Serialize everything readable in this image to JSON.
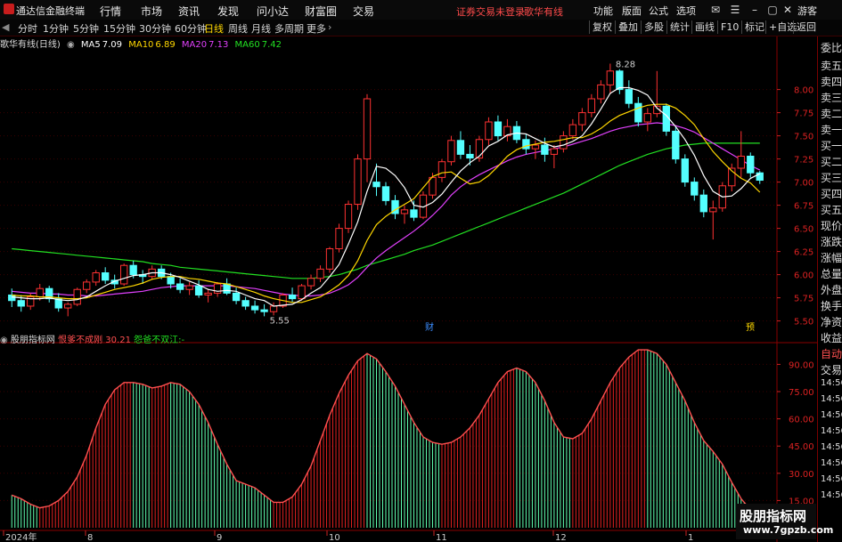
{
  "titlebar": {
    "app_title": "通达信金融终端",
    "menus": [
      "行情",
      "市场",
      "资讯",
      "发现",
      "问小达",
      "财富圈",
      "交易"
    ],
    "warning": "证券交易未登录",
    "stock_name": "歌华有线",
    "right_menus": [
      "功能",
      "版面",
      "公式",
      "选项"
    ],
    "user": "游客"
  },
  "toolbar": {
    "periods": [
      "分时",
      "1分钟",
      "5分钟",
      "15分钟",
      "30分钟",
      "60分钟",
      "日线",
      "周线",
      "月线",
      "多周期",
      "更多"
    ],
    "active_period": "日线",
    "buttons": [
      "复权",
      "叠加",
      "多股",
      "统计",
      "画线",
      "F10",
      "标记",
      "+自选",
      "返回"
    ]
  },
  "main_chart": {
    "label": "歌华有线(日线)",
    "ma": [
      {
        "name": "MA5",
        "value": "7.09",
        "color": "#ffffff"
      },
      {
        "name": "MA10",
        "value": "6.89",
        "color": "#ffd700"
      },
      {
        "name": "MA20",
        "value": "7.13",
        "color": "#e040fb"
      },
      {
        "name": "MA60",
        "value": "7.42",
        "color": "#22e022"
      }
    ],
    "high_label": "8.28",
    "low_label": "5.55",
    "markers": [
      "财",
      "预"
    ]
  },
  "indicator": {
    "name": "股朋指标网",
    "line1_label": "恨爹不成刚",
    "line1_value": "30.21",
    "line2_label": "怨爸不双江",
    "line2_value": "-"
  },
  "right_panel": {
    "items": [
      "委比",
      "卖五",
      "卖四",
      "卖三",
      "卖二",
      "卖一",
      "买一",
      "买二",
      "买三",
      "买四",
      "买五",
      "现价",
      "涨跌",
      "涨幅",
      "总量",
      "外盘",
      "换手",
      "净资",
      "收益",
      "自动",
      "交易"
    ],
    "times": [
      "14:56",
      "14:56",
      "14:56",
      "14:56",
      "14:56",
      "14:56",
      "14:56",
      "14:56"
    ]
  },
  "watermark": {
    "name": "股朋指标网",
    "url": "www.7gpzb.com"
  },
  "chart_data": {
    "type": "candlestick",
    "price_axis": {
      "ticks": [
        "8.00",
        "7.75",
        "7.50",
        "7.25",
        "7.00",
        "6.75",
        "6.50",
        "6.25",
        "6.00",
        "5.75",
        "5.50"
      ],
      "range": [
        5.4,
        8.4
      ]
    },
    "indicator_axis": {
      "ticks": [
        "90.00",
        "75.00",
        "60.00",
        "45.00",
        "30.00",
        "15.00"
      ],
      "range": [
        0,
        100
      ]
    },
    "x_labels": [
      "2024年",
      "8",
      "9",
      "10",
      "11",
      "12",
      "1"
    ],
    "ohlc": [
      [
        5.78,
        5.85,
        5.65,
        5.72
      ],
      [
        5.72,
        5.78,
        5.6,
        5.66
      ],
      [
        5.66,
        5.8,
        5.62,
        5.76
      ],
      [
        5.76,
        5.9,
        5.72,
        5.85
      ],
      [
        5.85,
        5.88,
        5.7,
        5.74
      ],
      [
        5.74,
        5.8,
        5.6,
        5.64
      ],
      [
        5.64,
        5.7,
        5.55,
        5.68
      ],
      [
        5.68,
        5.86,
        5.66,
        5.84
      ],
      [
        5.84,
        5.95,
        5.8,
        5.92
      ],
      [
        5.92,
        6.05,
        5.88,
        6.02
      ],
      [
        6.02,
        6.08,
        5.9,
        5.94
      ],
      [
        5.94,
        6.0,
        5.85,
        5.9
      ],
      [
        5.9,
        6.12,
        5.88,
        6.1
      ],
      [
        6.1,
        6.15,
        5.96,
        6.0
      ],
      [
        6.0,
        6.05,
        5.9,
        5.98
      ],
      [
        5.98,
        6.1,
        5.95,
        6.06
      ],
      [
        6.06,
        6.1,
        5.95,
        5.98
      ],
      [
        5.98,
        6.02,
        5.85,
        5.9
      ],
      [
        5.9,
        5.96,
        5.8,
        5.84
      ],
      [
        5.84,
        5.92,
        5.78,
        5.88
      ],
      [
        5.88,
        5.94,
        5.75,
        5.78
      ],
      [
        5.78,
        5.84,
        5.7,
        5.8
      ],
      [
        5.8,
        5.92,
        5.76,
        5.9
      ],
      [
        5.9,
        5.96,
        5.78,
        5.8
      ],
      [
        5.8,
        5.86,
        5.68,
        5.72
      ],
      [
        5.72,
        5.76,
        5.62,
        5.66
      ],
      [
        5.66,
        5.72,
        5.58,
        5.62
      ],
      [
        5.62,
        5.68,
        5.55,
        5.6
      ],
      [
        5.6,
        5.7,
        5.56,
        5.66
      ],
      [
        5.66,
        5.8,
        5.64,
        5.78
      ],
      [
        5.78,
        5.86,
        5.7,
        5.74
      ],
      [
        5.74,
        5.9,
        5.72,
        5.88
      ],
      [
        5.88,
        6.0,
        5.84,
        5.96
      ],
      [
        5.96,
        6.1,
        5.92,
        6.06
      ],
      [
        6.06,
        6.3,
        6.02,
        6.28
      ],
      [
        6.28,
        6.55,
        6.24,
        6.5
      ],
      [
        6.5,
        6.8,
        6.45,
        6.76
      ],
      [
        6.76,
        7.3,
        6.7,
        7.25
      ],
      [
        7.25,
        7.95,
        7.0,
        7.9
      ],
      [
        7.0,
        7.2,
        6.85,
        6.95
      ],
      [
        6.95,
        7.0,
        6.75,
        6.8
      ],
      [
        6.8,
        6.86,
        6.6,
        6.66
      ],
      [
        6.66,
        6.75,
        6.55,
        6.7
      ],
      [
        6.7,
        6.8,
        6.58,
        6.62
      ],
      [
        6.62,
        6.9,
        6.6,
        6.86
      ],
      [
        6.86,
        7.1,
        6.82,
        7.05
      ],
      [
        7.05,
        7.25,
        7.0,
        7.22
      ],
      [
        7.22,
        7.5,
        7.18,
        7.45
      ],
      [
        7.45,
        7.55,
        7.25,
        7.3
      ],
      [
        7.3,
        7.4,
        7.18,
        7.26
      ],
      [
        7.26,
        7.5,
        7.22,
        7.46
      ],
      [
        7.46,
        7.7,
        7.4,
        7.65
      ],
      [
        7.65,
        7.72,
        7.45,
        7.5
      ],
      [
        7.5,
        7.68,
        7.44,
        7.6
      ],
      [
        7.6,
        7.66,
        7.42,
        7.46
      ],
      [
        7.46,
        7.52,
        7.3,
        7.36
      ],
      [
        7.36,
        7.45,
        7.25,
        7.4
      ],
      [
        7.4,
        7.48,
        7.22,
        7.3
      ],
      [
        7.3,
        7.4,
        7.15,
        7.36
      ],
      [
        7.36,
        7.55,
        7.32,
        7.5
      ],
      [
        7.5,
        7.68,
        7.46,
        7.62
      ],
      [
        7.62,
        7.8,
        7.55,
        7.75
      ],
      [
        7.75,
        7.95,
        7.7,
        7.9
      ],
      [
        7.9,
        8.1,
        7.85,
        8.05
      ],
      [
        8.05,
        8.28,
        7.95,
        8.2
      ],
      [
        8.2,
        8.22,
        7.95,
        8.0
      ],
      [
        8.0,
        8.1,
        7.8,
        7.85
      ],
      [
        7.85,
        7.92,
        7.6,
        7.65
      ],
      [
        7.65,
        7.8,
        7.55,
        7.74
      ],
      [
        7.74,
        8.2,
        7.7,
        7.82
      ],
      [
        7.82,
        7.85,
        7.5,
        7.55
      ],
      [
        7.55,
        7.6,
        7.2,
        7.25
      ],
      [
        7.25,
        7.3,
        6.95,
        7.0
      ],
      [
        7.0,
        7.05,
        6.8,
        6.86
      ],
      [
        6.86,
        6.92,
        6.62,
        6.68
      ],
      [
        6.68,
        6.8,
        6.38,
        6.72
      ],
      [
        6.72,
        7.0,
        6.68,
        6.96
      ],
      [
        6.96,
        7.2,
        6.9,
        7.15
      ],
      [
        7.15,
        7.55,
        7.05,
        7.28
      ],
      [
        7.28,
        7.32,
        7.05,
        7.1
      ],
      [
        7.1,
        7.12,
        6.98,
        7.02
      ]
    ],
    "ma5": [
      5.76,
      5.75,
      5.74,
      5.74,
      5.75,
      5.73,
      5.72,
      5.73,
      5.76,
      5.82,
      5.88,
      5.93,
      5.96,
      5.99,
      6.0,
      6.02,
      6.02,
      6.0,
      5.97,
      5.93,
      5.89,
      5.84,
      5.82,
      5.83,
      5.82,
      5.78,
      5.74,
      5.72,
      5.66,
      5.67,
      5.68,
      5.73,
      5.8,
      5.86,
      5.98,
      6.11,
      6.33,
      6.57,
      6.9,
      7.17,
      7.15,
      7.07,
      6.94,
      6.75,
      6.73,
      6.78,
      6.87,
      7.0,
      7.12,
      7.21,
      7.28,
      7.39,
      7.44,
      7.51,
      7.53,
      7.52,
      7.47,
      7.42,
      7.38,
      7.4,
      7.44,
      7.5,
      7.63,
      7.79,
      7.96,
      8.02,
      8.02,
      7.99,
      7.94,
      7.8,
      7.72,
      7.6,
      7.46,
      7.29,
      7.07,
      6.9,
      6.84,
      6.85,
      6.93,
      7.04,
      7.09
    ],
    "ma10": [
      5.78,
      5.77,
      5.77,
      5.76,
      5.76,
      5.75,
      5.74,
      5.74,
      5.75,
      5.78,
      5.81,
      5.84,
      5.86,
      5.88,
      5.91,
      5.95,
      5.97,
      5.98,
      5.98,
      5.96,
      5.95,
      5.93,
      5.91,
      5.9,
      5.87,
      5.84,
      5.81,
      5.77,
      5.74,
      5.72,
      5.7,
      5.7,
      5.73,
      5.76,
      5.82,
      5.89,
      5.99,
      6.15,
      6.37,
      6.54,
      6.63,
      6.7,
      6.76,
      6.82,
      6.94,
      7.06,
      7.1,
      7.11,
      7.04,
      6.98,
      7.0,
      7.07,
      7.17,
      7.28,
      7.35,
      7.39,
      7.41,
      7.43,
      7.44,
      7.46,
      7.48,
      7.48,
      7.52,
      7.58,
      7.66,
      7.72,
      7.76,
      7.8,
      7.83,
      7.84,
      7.84,
      7.8,
      7.72,
      7.62,
      7.47,
      7.33,
      7.22,
      7.12,
      7.04,
      6.99,
      6.89
    ],
    "ma20": [
      5.82,
      5.81,
      5.8,
      5.8,
      5.79,
      5.79,
      5.78,
      5.78,
      5.77,
      5.77,
      5.78,
      5.79,
      5.8,
      5.81,
      5.82,
      5.84,
      5.86,
      5.87,
      5.88,
      5.88,
      5.88,
      5.88,
      5.88,
      5.88,
      5.87,
      5.86,
      5.85,
      5.83,
      5.81,
      5.79,
      5.78,
      5.77,
      5.77,
      5.78,
      5.8,
      5.84,
      5.89,
      5.97,
      6.08,
      6.18,
      6.26,
      6.33,
      6.4,
      6.47,
      6.55,
      6.64,
      6.74,
      6.86,
      6.95,
      7.02,
      7.08,
      7.13,
      7.18,
      7.23,
      7.27,
      7.3,
      7.32,
      7.34,
      7.36,
      7.38,
      7.41,
      7.44,
      7.47,
      7.51,
      7.55,
      7.58,
      7.6,
      7.62,
      7.63,
      7.64,
      7.63,
      7.61,
      7.58,
      7.54,
      7.48,
      7.42,
      7.36,
      7.3,
      7.24,
      7.18,
      7.13
    ],
    "ma60": [
      6.28,
      6.27,
      6.26,
      6.25,
      6.24,
      6.23,
      6.22,
      6.21,
      6.2,
      6.19,
      6.18,
      6.17,
      6.16,
      6.15,
      6.14,
      6.12,
      6.11,
      6.1,
      6.08,
      6.07,
      6.06,
      6.05,
      6.04,
      6.03,
      6.02,
      6.01,
      6.0,
      5.99,
      5.98,
      5.97,
      5.96,
      5.96,
      5.96,
      5.97,
      5.98,
      6.0,
      6.03,
      6.06,
      6.1,
      6.13,
      6.16,
      6.19,
      6.22,
      6.26,
      6.29,
      6.32,
      6.36,
      6.4,
      6.44,
      6.48,
      6.52,
      6.56,
      6.6,
      6.64,
      6.68,
      6.72,
      6.76,
      6.8,
      6.84,
      6.88,
      6.93,
      6.98,
      7.03,
      7.08,
      7.13,
      7.18,
      7.22,
      7.26,
      7.3,
      7.33,
      7.36,
      7.38,
      7.4,
      7.41,
      7.42,
      7.42,
      7.42,
      7.42,
      7.42,
      7.42,
      7.42
    ],
    "indicator_values": [
      18,
      16,
      13,
      11,
      12,
      15,
      20,
      28,
      40,
      55,
      68,
      76,
      80,
      80,
      79,
      77,
      78,
      80,
      79,
      75,
      68,
      58,
      46,
      35,
      26,
      24,
      22,
      18,
      14,
      14,
      17,
      24,
      34,
      48,
      62,
      74,
      84,
      92,
      96,
      93,
      86,
      78,
      68,
      58,
      50,
      47,
      46,
      47,
      50,
      55,
      62,
      71,
      80,
      86,
      88,
      86,
      80,
      70,
      58,
      50,
      49,
      52,
      60,
      70,
      80,
      88,
      94,
      98,
      98,
      96,
      90,
      80,
      70,
      58,
      48,
      42,
      35,
      25,
      16,
      10,
      5
    ]
  }
}
